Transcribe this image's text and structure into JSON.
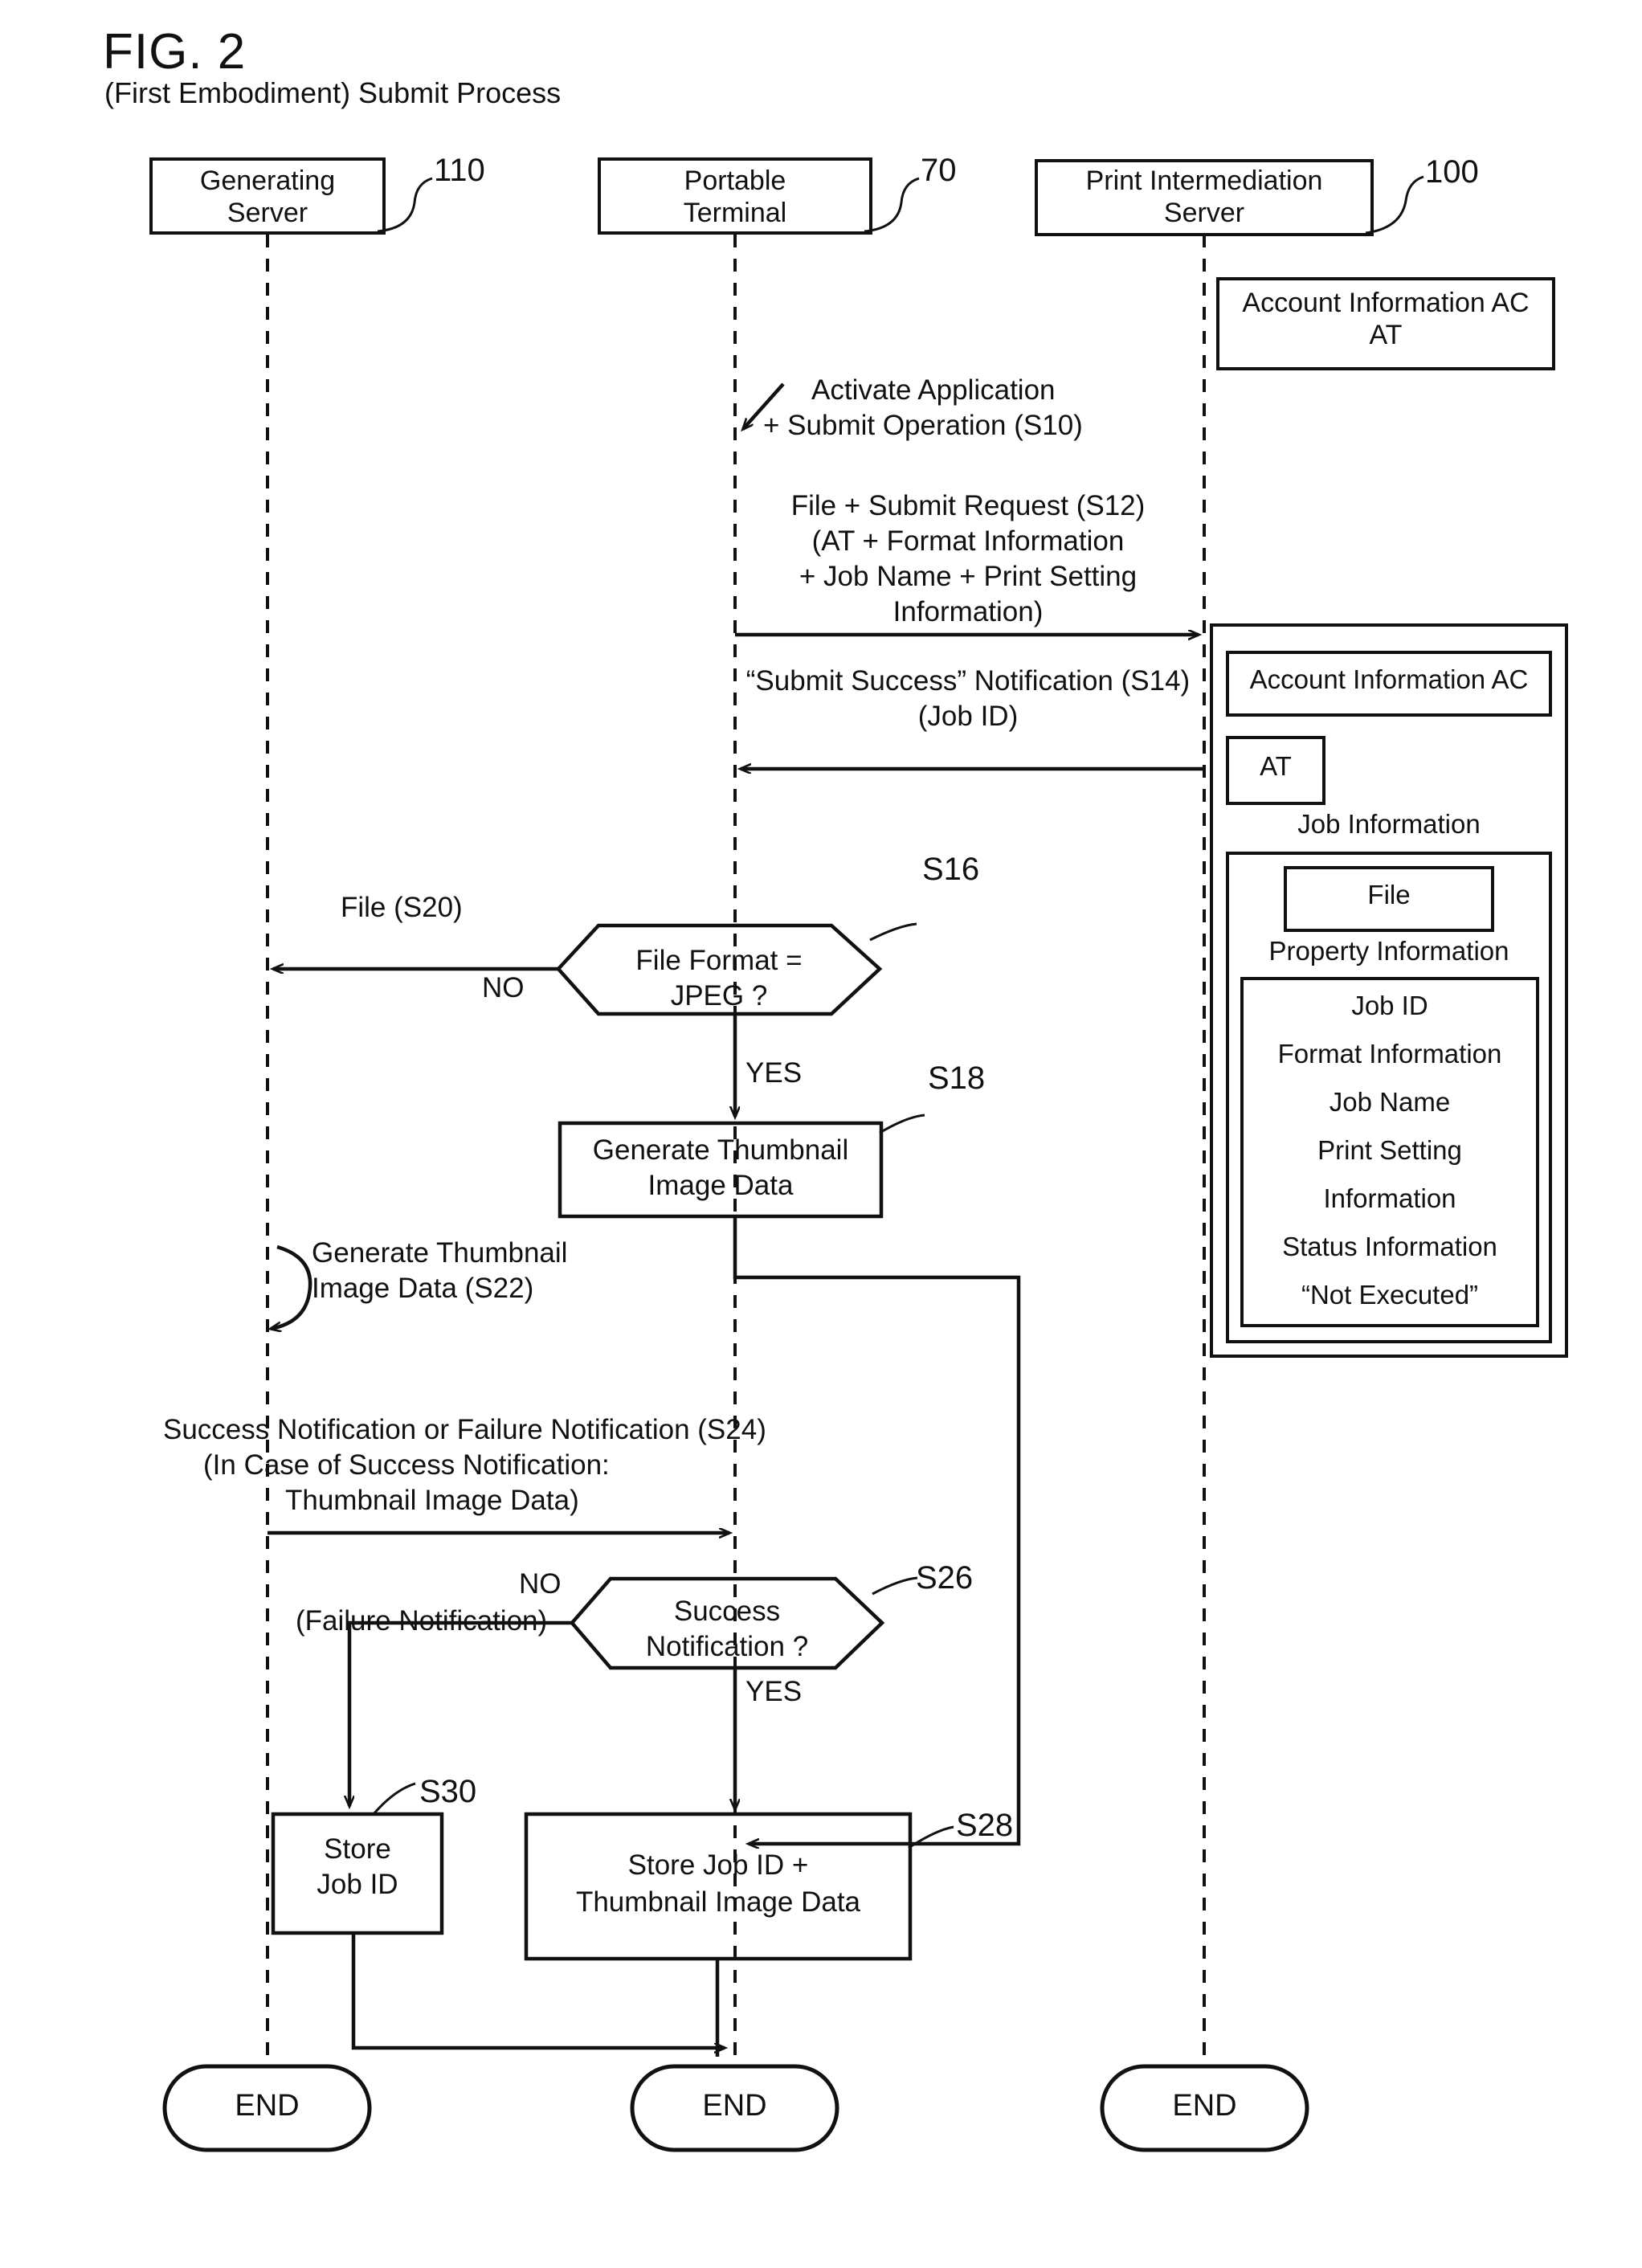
{
  "figure": {
    "number": "FIG. 2",
    "subtitle": "(First Embodiment) Submit Process"
  },
  "lifelines": [
    {
      "id": "generating-server",
      "title_line1": "Generating",
      "title_line2": "Server",
      "ref": "110"
    },
    {
      "id": "portable-terminal",
      "title_line1": "Portable",
      "title_line2": "Terminal",
      "ref": "70"
    },
    {
      "id": "print-intermediation-server",
      "title_line1": "Print Intermediation",
      "title_line2": "Server",
      "ref": "100"
    }
  ],
  "account_box_top": {
    "line1": "Account Information AC",
    "line2": "AT"
  },
  "messages": {
    "s10": {
      "line1": "Activate Application",
      "line2": "+ Submit Operation (S10)"
    },
    "s12": {
      "line1": "File + Submit Request (S12)",
      "line2": "(AT + Format Information",
      "line3": "+ Job Name + Print Setting",
      "line4": "Information)"
    },
    "s14": {
      "line1": "“Submit Success” Notification (S14)",
      "line2": "(Job ID)"
    },
    "s20": {
      "label": "File (S20)"
    },
    "s22": {
      "line1": "Generate Thumbnail",
      "line2": "Image Data (S22)"
    },
    "s24": {
      "line1": "Success Notification or Failure Notification (S24)",
      "line2": "(In Case of Success Notification:",
      "line3": "Thumbnail Image Data)"
    }
  },
  "job_panel": {
    "account_information": "Account Information AC",
    "at": "AT",
    "job_information_label": "Job Information",
    "file": "File",
    "property_information_label": "Property Information",
    "properties": [
      "Job ID",
      "Format Information",
      "Job Name",
      "Print Setting",
      "Information",
      "Status Information",
      "“Not Executed”"
    ]
  },
  "nodes": {
    "s16": {
      "ref": "S16",
      "line1": "File Format =",
      "line2": "JPEG ?",
      "yes": "YES",
      "no": "NO"
    },
    "s18": {
      "ref": "S18",
      "line1": "Generate Thumbnail",
      "line2": "Image Data"
    },
    "s26": {
      "ref": "S26",
      "line1": "Success",
      "line2": "Notification ?",
      "yes": "YES",
      "no": "NO",
      "no_sub": "(Failure Notification)"
    },
    "s30": {
      "ref": "S30",
      "line1": "Store",
      "line2": "Job ID"
    },
    "s28": {
      "ref": "S28",
      "line1": "Store Job ID +",
      "line2": "Thumbnail Image Data"
    }
  },
  "terminators": {
    "end_left": "END",
    "end_mid": "END",
    "end_right": "END"
  },
  "colors": {
    "ink": "#111111",
    "paper": "#ffffff"
  }
}
